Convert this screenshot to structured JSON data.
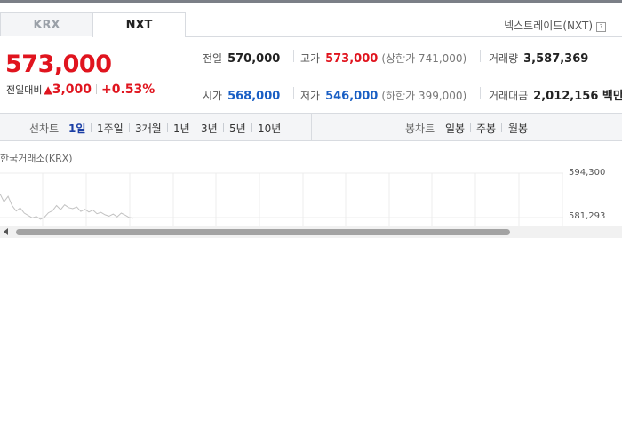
{
  "tabs": [
    {
      "label": "KRX",
      "active": false
    },
    {
      "label": "NXT",
      "active": true
    }
  ],
  "nxt_link": {
    "label": "넥스트레이드(NXT)",
    "icon": "question-icon",
    "icon_glyph": "?"
  },
  "price": {
    "current": "573,000",
    "change_label": "전일대비",
    "change_arrow": "▲",
    "change_value": "3,000",
    "change_pct": "+0.53%",
    "up_color": "#e0141e"
  },
  "stats": {
    "prev_close": {
      "label": "전일",
      "value": "570,000"
    },
    "high": {
      "label": "고가",
      "value": "573,000",
      "limit": "(상한가 741,000)"
    },
    "volume": {
      "label": "거래량",
      "value": "3,587,369"
    },
    "open": {
      "label": "시가",
      "value": "568,000"
    },
    "low": {
      "label": "저가",
      "value": "546,000",
      "limit": "(하한가 399,000)"
    },
    "amount": {
      "label": "거래대금",
      "value": "2,012,156 백만"
    }
  },
  "line_chart": {
    "label": "선차트",
    "periods": [
      "1일",
      "1주일",
      "3개월",
      "1년",
      "3년",
      "5년",
      "10년"
    ],
    "active": "1일"
  },
  "candle_chart": {
    "label": "봉차트",
    "periods": [
      "일봉",
      "주봉",
      "월봉"
    ]
  },
  "chart_data": {
    "type": "line",
    "title": "한국거래소(KRX)",
    "ytick_labels": [
      "594,300",
      "581,293"
    ],
    "y": [
      588200,
      585900,
      587500,
      584800,
      583200,
      584100,
      582600,
      581900,
      581200,
      581600,
      580800,
      581400,
      582700,
      583300,
      584800,
      583600,
      585000,
      584200,
      583900,
      584400,
      583100,
      583700,
      582900,
      583500,
      582400,
      582800,
      582100,
      581700,
      582300,
      581500,
      582600,
      582000,
      581300,
      581100
    ],
    "grid": true
  }
}
